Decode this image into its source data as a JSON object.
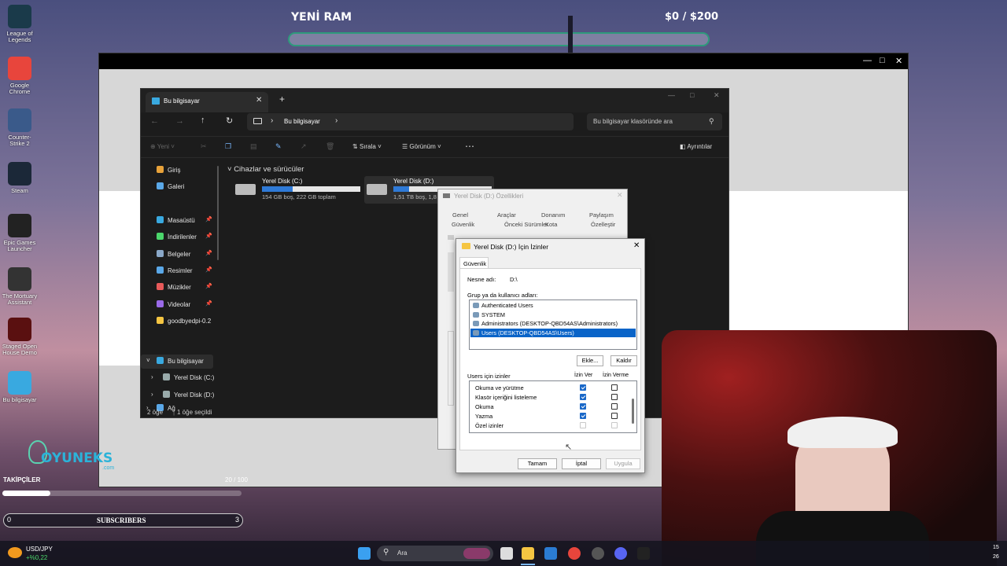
{
  "overlay": {
    "ram_title": "YENİ RAM",
    "ram_value": "$0 / $200",
    "ram_progress": 0,
    "brand": "OYUNEKS",
    "brand_sub": ".com",
    "followers_label": "TAKİPÇİLER",
    "followers_value": "20 / 100",
    "subs_left": "0",
    "subs_label": "SUBSCRIBERS",
    "subs_right": "3",
    "ticker_name": "USD/JPY",
    "ticker_change": "+%0,22"
  },
  "desktop_icons": [
    {
      "label": "League of Legends",
      "color": "#1a3a4a"
    },
    {
      "label": "Google Chrome",
      "color": "#e8453c"
    },
    {
      "label": "Counter-Strike 2",
      "color": "#3a5a8a"
    },
    {
      "label": "Steam",
      "color": "#1b2838"
    },
    {
      "label": "Epic Games Launcher",
      "color": "#222"
    },
    {
      "label": "The Mortuary Assistant",
      "color": "#333"
    },
    {
      "label": "Staged Open House Demo",
      "color": "#5a1010"
    },
    {
      "label": "Bu bilgisayar",
      "color": "#39a9e0"
    }
  ],
  "explorer": {
    "tab_title": "Bu bilgisayar",
    "breadcrumb": "Bu bilgisayar",
    "search_placeholder": "Bu bilgisayar klasöründe ara",
    "toolbar": {
      "new": "Yeni",
      "sort": "Sırala",
      "view": "Görünüm",
      "details": "Ayrıntılar"
    },
    "nav": {
      "home": "Giriş",
      "gallery": "Galeri",
      "quick": [
        "Masaüstü",
        "İndirilenler",
        "Belgeler",
        "Resimler",
        "Müzikler",
        "Videolar",
        "goodbyedpi-0.2"
      ],
      "this_pc": "Bu bilgisayar",
      "drive_c": "Yerel Disk (C:)",
      "drive_d": "Yerel Disk (D:)",
      "network": "Ağ"
    },
    "section_title": "Cihazlar ve sürücüler",
    "drives": [
      {
        "name": "Yerel Disk (C:)",
        "info": "154 GB boş, 222 GB toplam",
        "used_fraction": 0.31
      },
      {
        "name": "Yerel Disk (D:)",
        "info": "1,51 TB boş, 1,8",
        "used_fraction": 0.16
      }
    ],
    "status": {
      "count": "2 öğe",
      "selected": "1 öğe seçildi"
    }
  },
  "properties": {
    "title": "Yerel Disk (D:) Özellikleri",
    "tabs_row1": [
      "Genel",
      "Araçlar",
      "Donanım",
      "Paylaşım"
    ],
    "tabs_row2": [
      "Güvenlik",
      "Önceki Sürümler",
      "Kota",
      "Özelleştir"
    ]
  },
  "permissions": {
    "title": "Yerel Disk (D:) İçin İzinler",
    "tab": "Güvenlik",
    "object_label": "Nesne adı:",
    "object_value": "D:\\",
    "group_label": "Grup ya da kullanıcı adları:",
    "groups": [
      "Authenticated Users",
      "SYSTEM",
      "Administrators (DESKTOP-QBD54AS\\Administrators)",
      "Users (DESKTOP-QBD54AS\\Users)"
    ],
    "selected_group": 3,
    "add": "Ekle...",
    "remove": "Kaldır",
    "perm_label": "Users için izinler",
    "allow": "İzin Ver",
    "deny": "İzin Verme",
    "perms": [
      {
        "name": "Okuma ve yürütme",
        "allow": true,
        "deny": false,
        "disabled": false
      },
      {
        "name": "Klasör içeriğini listeleme",
        "allow": true,
        "deny": false,
        "disabled": false
      },
      {
        "name": "Okuma",
        "allow": true,
        "deny": false,
        "disabled": false
      },
      {
        "name": "Yazma",
        "allow": true,
        "deny": false,
        "disabled": false
      },
      {
        "name": "Özel izinler",
        "allow": false,
        "deny": false,
        "disabled": true
      }
    ],
    "ok": "Tamam",
    "cancel": "İptal",
    "apply": "Uygula"
  },
  "taskbar": {
    "search": "Ara",
    "time": "15",
    "date": "26"
  }
}
